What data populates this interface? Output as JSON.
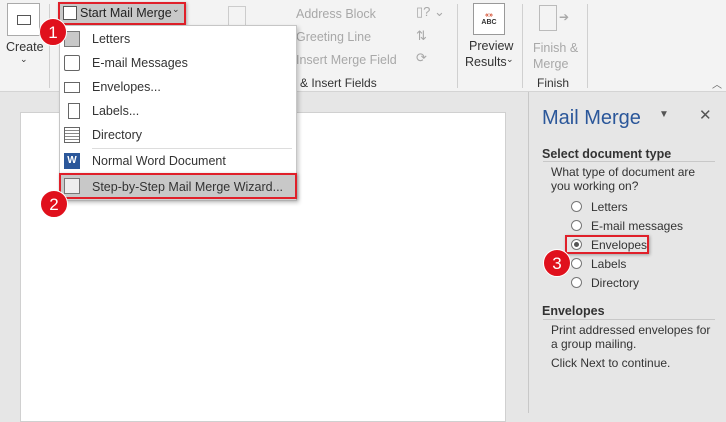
{
  "ribbon": {
    "create_label": "Create",
    "start_mail_merge": "Start Mail Merge",
    "address_block": "Address Block",
    "greeting_line": "Greeting Line",
    "insert_merge_field": "Insert Merge Field",
    "group_write_insert": "e & Insert Fields",
    "preview_line1": "Preview",
    "preview_line2": "Results",
    "finish_line1": "Finish &",
    "finish_line2": "Merge",
    "group_finish": "Finish"
  },
  "menu": {
    "items": [
      {
        "label": "Letters",
        "icon": "letter-icon"
      },
      {
        "label": "E-mail Messages",
        "icon": "email-icon"
      },
      {
        "label": "Envelopes...",
        "icon": "envelope-icon"
      },
      {
        "label": "Labels...",
        "icon": "labels-icon"
      },
      {
        "label": "Directory",
        "icon": "directory-icon"
      },
      {
        "label": "Normal Word Document",
        "icon": "word-icon"
      },
      {
        "label": "Step-by-Step Mail Merge Wizard...",
        "icon": "wizard-icon"
      }
    ]
  },
  "badges": [
    "1",
    "2",
    "3"
  ],
  "pane": {
    "title": "Mail Merge",
    "section1": "Select document type",
    "question": "What type of document are you working on?",
    "options": [
      "Letters",
      "E-mail messages",
      "Envelopes",
      "Labels",
      "Directory"
    ],
    "selected": "Envelopes",
    "section2": "Envelopes",
    "description": "Print addressed envelopes for a group mailing.",
    "next_hint": "Click Next to continue."
  },
  "colors": {
    "accent": "#2b579a",
    "highlight": "#e0202a"
  }
}
